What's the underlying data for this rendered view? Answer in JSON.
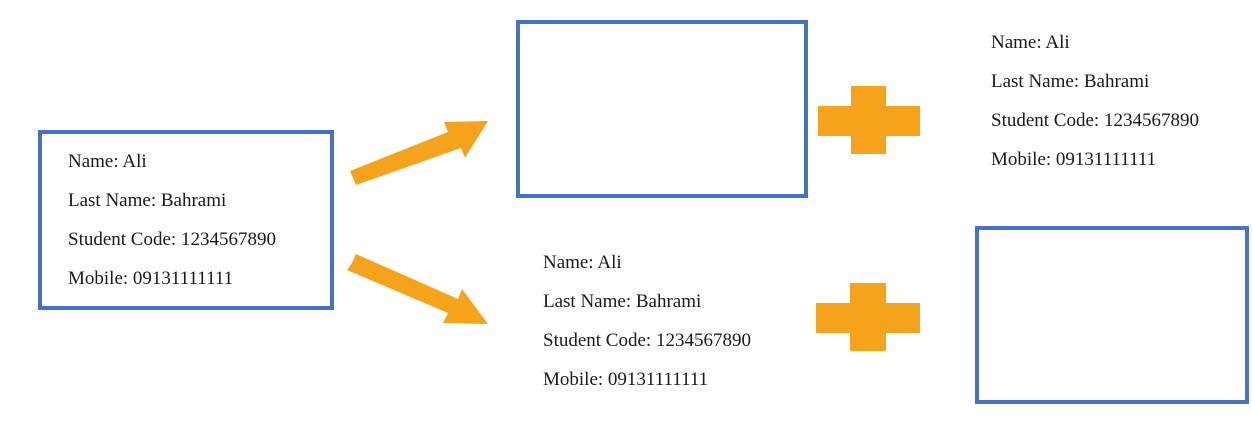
{
  "colors": {
    "box_border": "#4472c4",
    "accent_orange": "#f5a31a",
    "text": "#1a1a1a",
    "background": "#ffffff"
  },
  "source_record": {
    "name": "Name: Ali",
    "last_name": "Last Name: Bahrami",
    "student_code": "Student Code: 1234567890",
    "mobile": "Mobile: 09131111111"
  },
  "top_branch_record": {
    "name": "Name: Ali",
    "last_name": "Last Name: Bahrami",
    "student_code": "Student Code: 1234567890",
    "mobile": "Mobile: 09131111111"
  },
  "bottom_branch_record": {
    "name": "Name: Ali",
    "last_name": "Last Name: Bahrami",
    "student_code": "Student Code: 1234567890",
    "mobile": "Mobile: 09131111111"
  },
  "icons": [
    "arrow-icon",
    "plus-icon",
    "empty-box"
  ]
}
